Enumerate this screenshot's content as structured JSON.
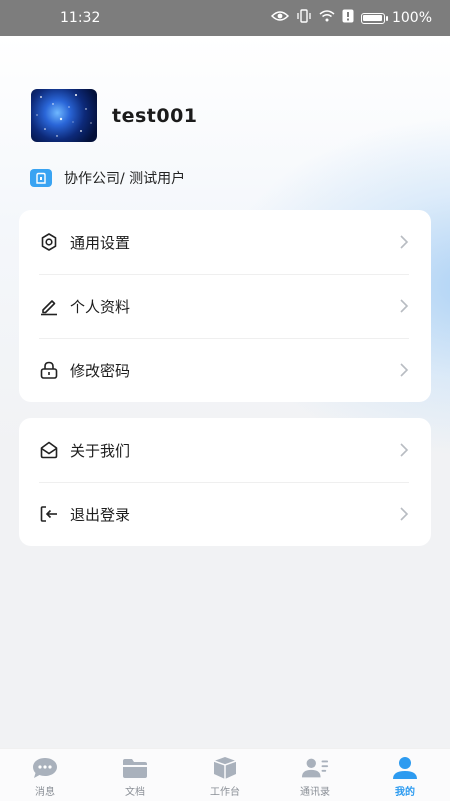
{
  "status_bar": {
    "time": "11:32",
    "battery": "100%",
    "icons": [
      "eye-icon",
      "vibrate-icon",
      "wifi-icon",
      "alert-icon",
      "battery-icon"
    ]
  },
  "profile": {
    "username": "test001",
    "company": "协作公司/ 测试用户"
  },
  "menu_group_1": [
    {
      "label": "通用设置",
      "icon": "gear-icon"
    },
    {
      "label": "个人资料",
      "icon": "pencil-icon"
    },
    {
      "label": "修改密码",
      "icon": "lock-icon"
    }
  ],
  "menu_group_2": [
    {
      "label": "关于我们",
      "icon": "mail-open-icon"
    },
    {
      "label": "退出登录",
      "icon": "logout-icon"
    }
  ],
  "tabs": [
    {
      "label": "消息",
      "icon": "chat-icon"
    },
    {
      "label": "文档",
      "icon": "folder-icon"
    },
    {
      "label": "工作台",
      "icon": "box-icon"
    },
    {
      "label": "通讯录",
      "icon": "contacts-icon"
    },
    {
      "label": "我的",
      "icon": "user-icon",
      "active": true
    }
  ],
  "colors": {
    "accent": "#2d9bf0",
    "tab_inactive": "#a9b1bc",
    "chevron": "#b8bcc2"
  }
}
